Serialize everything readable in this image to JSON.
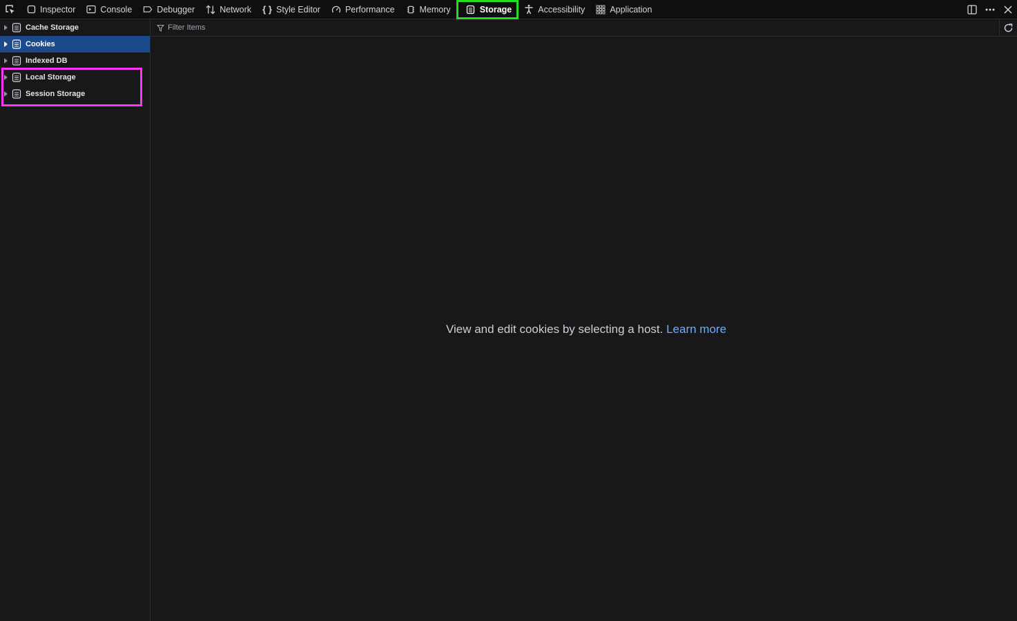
{
  "toolbar": {
    "picker_icon": "element-picker-icon",
    "tabs": [
      {
        "label": "Inspector",
        "icon": "inspector-icon"
      },
      {
        "label": "Console",
        "icon": "console-icon"
      },
      {
        "label": "Debugger",
        "icon": "debugger-icon"
      },
      {
        "label": "Network",
        "icon": "network-arrows-icon"
      },
      {
        "label": "Style Editor",
        "icon": "braces-icon"
      },
      {
        "label": "Performance",
        "icon": "gauge-icon"
      },
      {
        "label": "Memory",
        "icon": "memory-chip-icon"
      },
      {
        "label": "Storage",
        "icon": "storage-icon",
        "selected": true
      },
      {
        "label": "Accessibility",
        "icon": "accessibility-icon"
      },
      {
        "label": "Application",
        "icon": "grid-icon"
      }
    ],
    "right_icons": [
      "dock-icon",
      "more-icon",
      "close-icon"
    ]
  },
  "sidebar": {
    "items": [
      {
        "label": "Cache Storage"
      },
      {
        "label": "Cookies",
        "selected": true
      },
      {
        "label": "Indexed DB"
      },
      {
        "label": "Local Storage"
      },
      {
        "label": "Session Storage"
      }
    ]
  },
  "filter": {
    "placeholder": "Filter Items"
  },
  "main": {
    "message": "View and edit cookies by selecting a host.",
    "link": "Learn more"
  },
  "colors": {
    "highlight_green": "#22e01d",
    "highlight_magenta": "#ff35f5",
    "selected_row": "#1d4a8a",
    "link": "#6aaeff"
  }
}
